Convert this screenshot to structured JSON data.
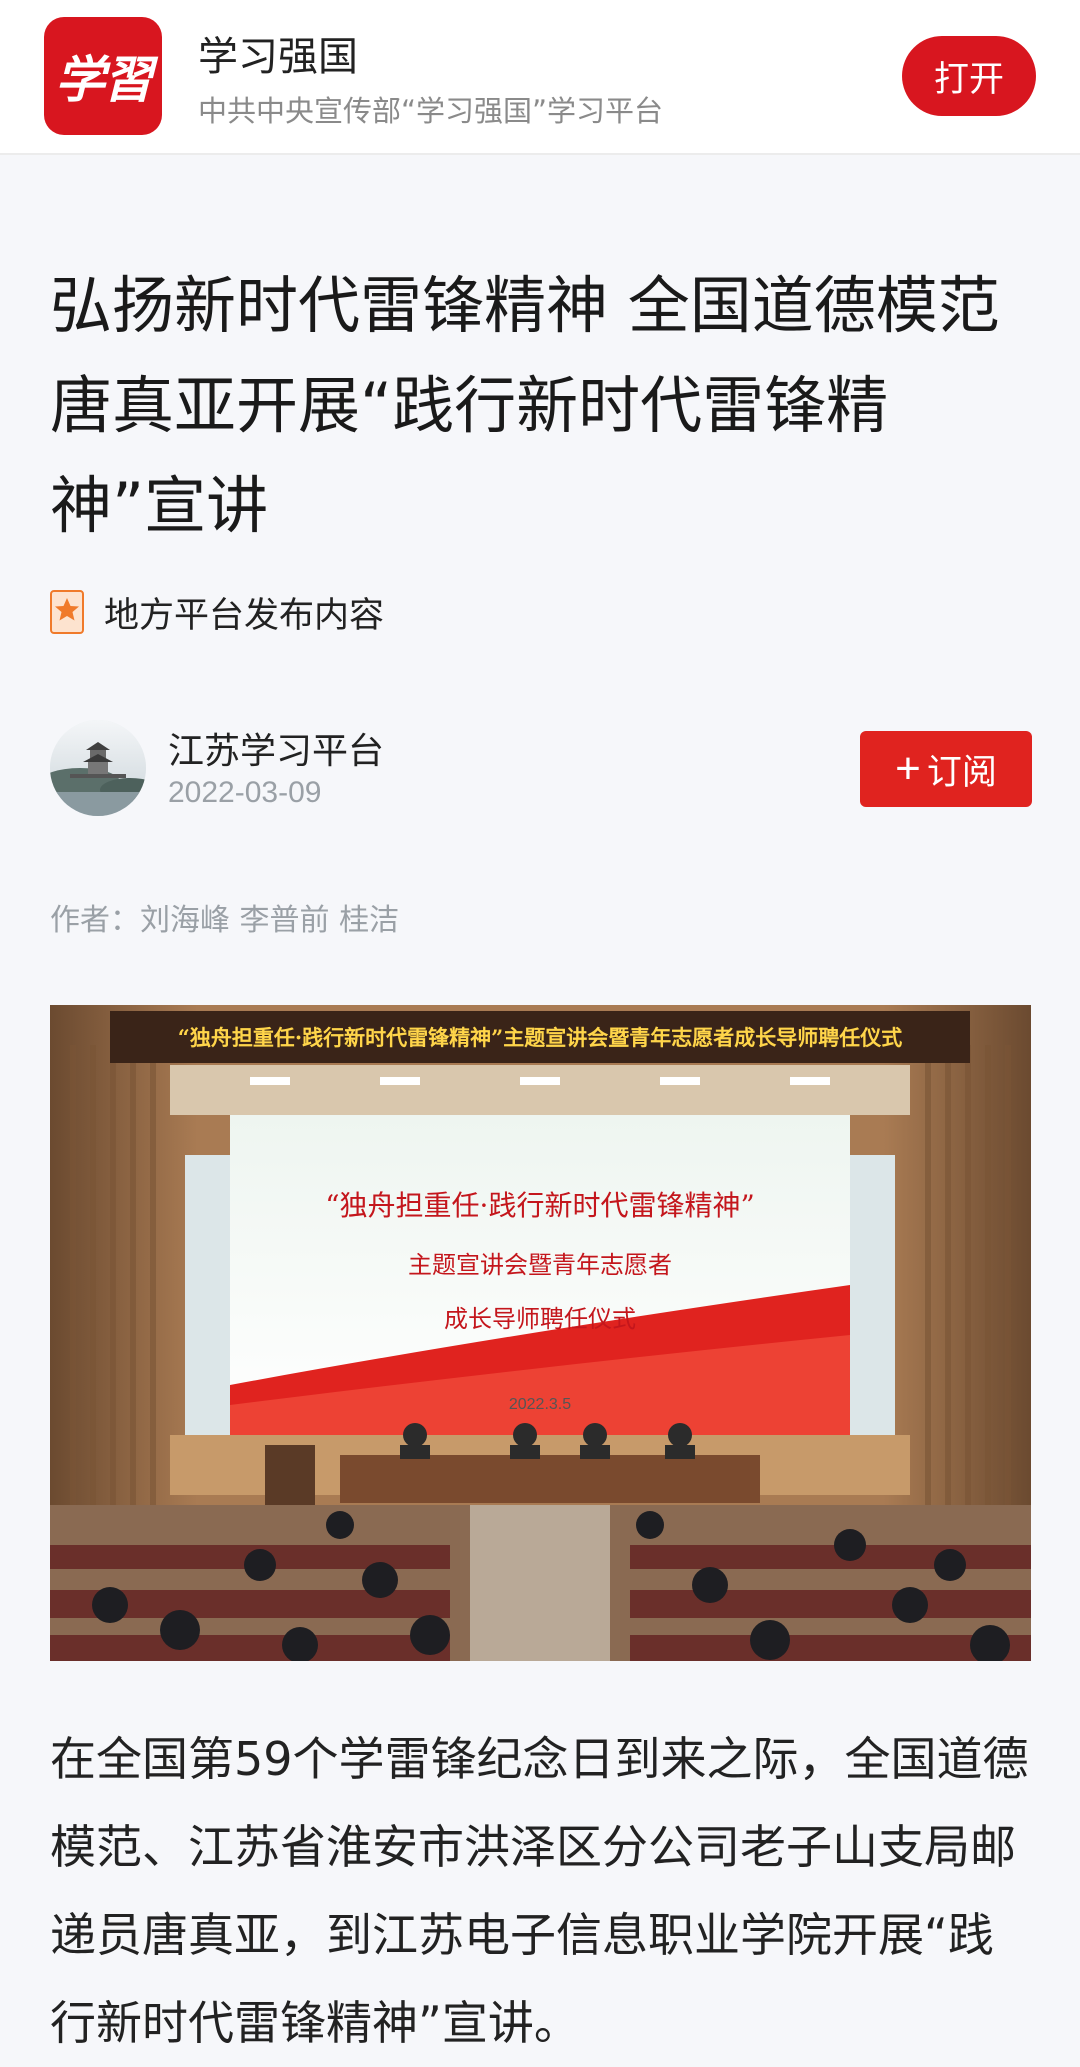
{
  "app": {
    "name": "学习强国",
    "subtitle": "中共中央宣传部“学习强国”学习平台",
    "logo_text": "学習",
    "open_label": "打开"
  },
  "article": {
    "title": "弘扬新时代雷锋精神 全国道德模范唐真亚开展“践行新时代雷锋精神”宣讲",
    "source_tag": "地方平台发布内容",
    "channel": "江苏学习平台",
    "date": "2022-03-09",
    "subscribe_label": "订阅",
    "byline": "作者：刘海峰 李普前 桂洁",
    "body": "在全国第59个学雷锋纪念日到来之际，全国道德模范、江苏省淮安市洪泽区分公司老子山支局邮递员唐真亚，到江苏电子信息职业学院开展“践行新时代雷锋精神”宣讲。"
  },
  "photo": {
    "banner": "“独舟担重任·践行新时代雷锋精神”主题宣讲会暨青年志愿者成长导师聘任仪式",
    "screen_line1": "“独舟担重任·践行新时代雷锋精神”",
    "screen_line2": "主题宣讲会暨青年志愿者",
    "screen_line3": "成长导师聘任仪式",
    "screen_date": "2022.3.5"
  },
  "colors": {
    "brand_red": "#d8161f",
    "subscribe_red": "#e0231f",
    "page_bg": "#f6f7fa"
  },
  "icons": {
    "source_tag": "bookmark-star-icon",
    "subscribe": "plus-icon"
  }
}
